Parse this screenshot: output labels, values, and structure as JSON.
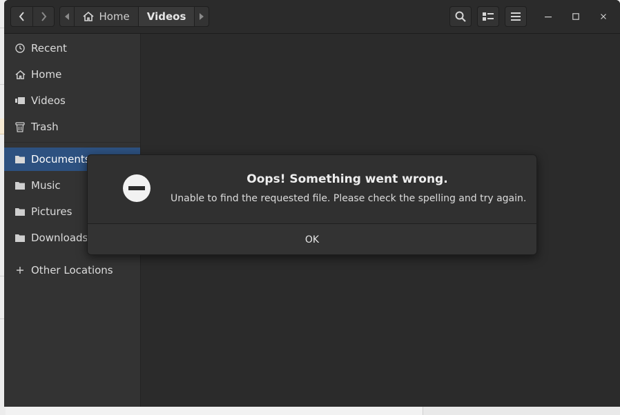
{
  "breadcrumb": {
    "home_label": "Home",
    "current_label": "Videos"
  },
  "sidebar": {
    "items": [
      {
        "label": "Recent",
        "icon": "clock-icon"
      },
      {
        "label": "Home",
        "icon": "home-icon"
      },
      {
        "label": "Videos",
        "icon": "video-icon"
      },
      {
        "label": "Trash",
        "icon": "trash-icon"
      },
      {
        "label": "Documents",
        "icon": "folder-icon",
        "selected": true
      },
      {
        "label": "Music",
        "icon": "folder-icon"
      },
      {
        "label": "Pictures",
        "icon": "folder-icon"
      },
      {
        "label": "Downloads",
        "icon": "folder-icon"
      },
      {
        "label": "Other Locations",
        "icon": "plus-icon"
      }
    ]
  },
  "dialog": {
    "title": "Oops! Something went wrong.",
    "message": "Unable to find the requested file. Please check the spelling and try again.",
    "ok_label": "OK",
    "icon": "error-minus-icon"
  },
  "colors": {
    "accent_selected": "#2d5180",
    "window_bg": "#2b2b2b",
    "sidebar_bg": "#333333"
  }
}
